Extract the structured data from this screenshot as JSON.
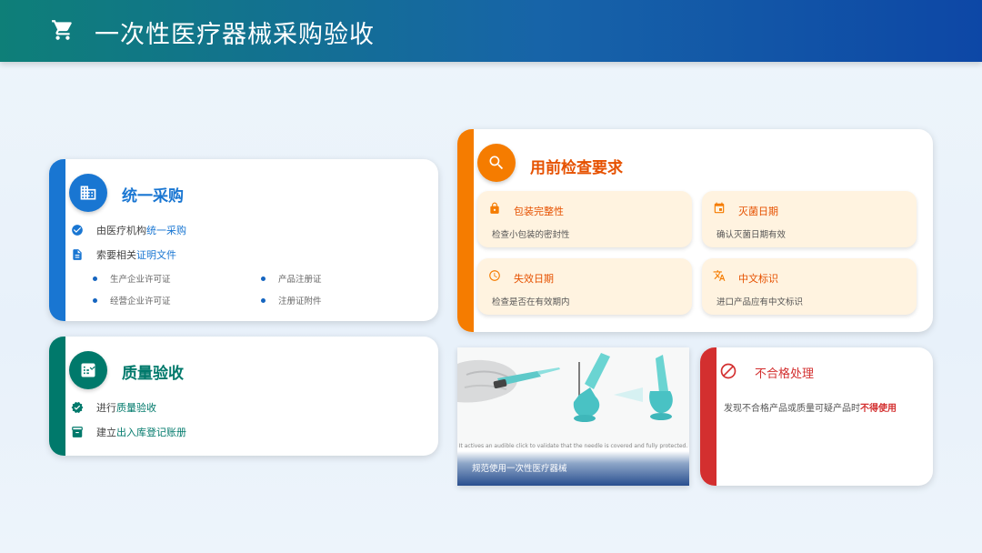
{
  "header": {
    "title": "一次性医疗器械采购验收",
    "icon": "cart-icon"
  },
  "procurement": {
    "title": "统一采购",
    "icon": "building-icon",
    "row1": {
      "prefix": "由医疗机构",
      "highlight": "统一采购"
    },
    "row2": {
      "prefix": "索要相关",
      "highlight": "证明文件"
    },
    "bullets": [
      "生产企业许可证",
      "产品注册证",
      "经营企业许可证",
      "注册证附件"
    ],
    "accent": "#1976d2"
  },
  "quality": {
    "title": "质量验收",
    "icon": "checklist-icon",
    "row1": {
      "prefix": "进行",
      "highlight": "质量验收"
    },
    "row2": {
      "prefix": "建立",
      "highlight": "出入库登记账册"
    },
    "accent": "#00796b"
  },
  "inspection": {
    "title": "用前检查要求",
    "icon": "search-icon",
    "accent": "#f57c00",
    "items": [
      {
        "title": "包装完整性",
        "desc": "检查小包装的密封性",
        "icon": "lock-icon"
      },
      {
        "title": "灭菌日期",
        "desc": "确认灭菌日期有效",
        "icon": "calendar-icon"
      },
      {
        "title": "失效日期",
        "desc": "检查是否在有效期内",
        "icon": "clock-icon"
      },
      {
        "title": "中文标识",
        "desc": "进口产品应有中文标识",
        "icon": "translate-icon"
      }
    ]
  },
  "photo": {
    "caption": "规范使用一次性医疗器械",
    "text": "It actives an audible click to validate that the needle is covered and fully protected."
  },
  "nonconforming": {
    "title": "不合格处理",
    "icon": "block-icon",
    "prefix": "发现不合格产品或质量可疑产品时",
    "highlight": "不得使用",
    "accent": "#d32f2f"
  }
}
